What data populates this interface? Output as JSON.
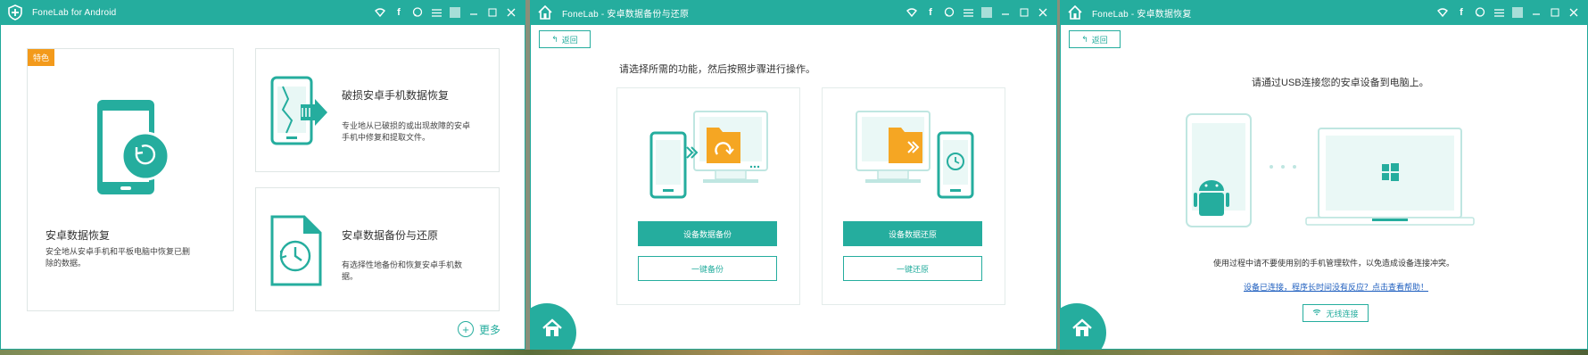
{
  "window1": {
    "title": "FoneLab for Android",
    "featured": {
      "badge": "特色",
      "title": "安卓数据恢复",
      "desc_line1": "安全地从安卓手机和平板电脑中恢复已删",
      "desc_line2": "除的数据。"
    },
    "broken": {
      "title": "破损安卓手机数据恢复",
      "desc_line1": "专业地从已破损的或出现故障的安卓",
      "desc_line2": "手机中修复和提取文件。"
    },
    "backup": {
      "title": "安卓数据备份与还原",
      "desc_line1": "有选择性地备份和恢复安卓手机数",
      "desc_line2": "据。"
    },
    "more_label": "更多"
  },
  "window2": {
    "title": "FoneLab - 安卓数据备份与还原",
    "back_label": "返回",
    "instruction": "请选择所需的功能，然后按照步骤进行操作。",
    "backup_button": "设备数据备份",
    "one_click_backup": "一键备份",
    "restore_button": "设备数据还原",
    "one_click_restore": "一键还原"
  },
  "window3": {
    "title": "FoneLab - 安卓数据恢复",
    "back_label": "返回",
    "instruction": "请通过USB连接您的安卓设备到电脑上。",
    "note": "使用过程中请不要使用别的手机管理软件，以免造成设备连接冲突。",
    "help_link": "设备已连接，程序长时间没有反应？点击查看帮助！",
    "wireless_label": "无线连接"
  },
  "colors": {
    "accent": "#25ad9e",
    "badge": "#f39a1b",
    "folder": "#f5a623",
    "link": "#1f5fbf"
  },
  "icons": [
    "shield-plus-icon",
    "wifi-icon",
    "facebook-icon",
    "chat-icon",
    "menu-icon",
    "minimize-icon",
    "maximize-icon",
    "close-icon",
    "home-icon",
    "back-arrow-icon",
    "plus-circle-icon",
    "android-icon",
    "windows-icon"
  ]
}
